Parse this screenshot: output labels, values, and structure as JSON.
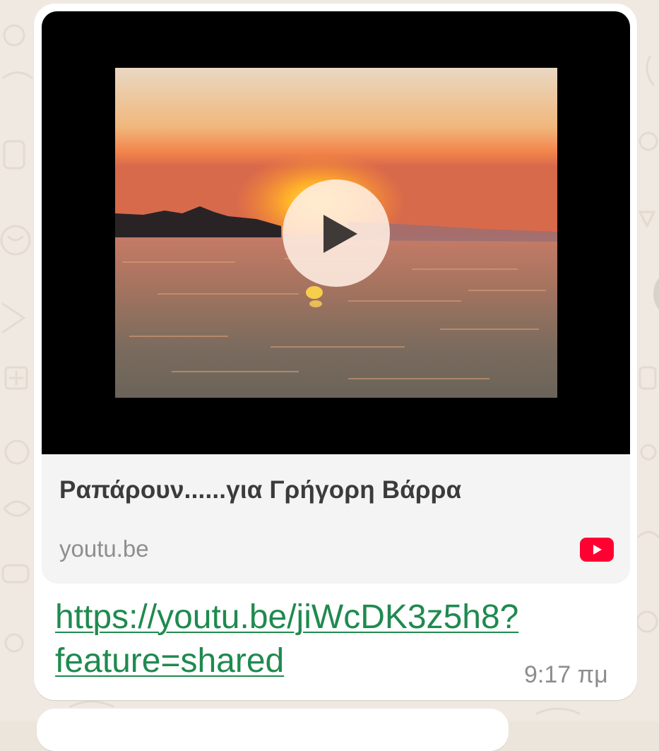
{
  "link_preview": {
    "title": "Ραπάρουν......για Γρήγορη Βάρρα",
    "domain": "youtu.be"
  },
  "message": {
    "url_line1": "https://youtu.be/jiWcDK3z5h8?",
    "url_line2": "feature=shared",
    "time": "9:17 πμ"
  },
  "icons": {
    "play": "play-icon",
    "youtube": "youtube-icon"
  },
  "colors": {
    "link": "#1f8a4f",
    "youtube_red": "#ff0033",
    "wallpaper": "#efe9e1"
  }
}
